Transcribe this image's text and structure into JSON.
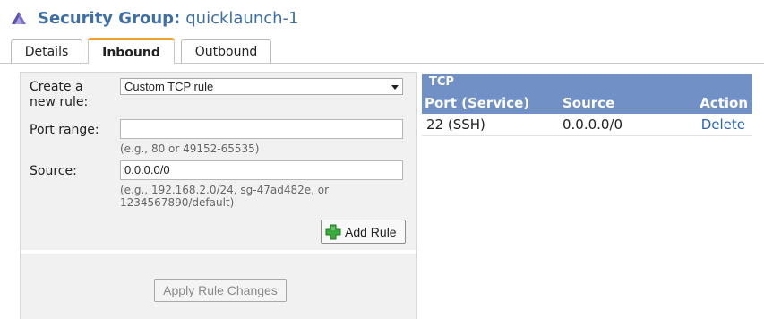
{
  "header": {
    "title_label": "Security Group:",
    "title_value": "quicklaunch-1",
    "icon": "security-group-icon"
  },
  "tabs": [
    {
      "label": "Details",
      "active": false
    },
    {
      "label": "Inbound",
      "active": true
    },
    {
      "label": "Outbound",
      "active": false
    }
  ],
  "form": {
    "create_rule_label": "Create a new rule:",
    "rule_type_selected": "Custom TCP rule",
    "port_range_label": "Port range:",
    "port_range_value": "",
    "port_range_hint": "(e.g., 80 or 49152-65535)",
    "source_label": "Source:",
    "source_value": "0.0.0.0/0",
    "source_hint": "(e.g., 192.168.2.0/24, sg-47ad482e, or 1234567890/default)",
    "add_rule_label": "Add Rule",
    "apply_label": "Apply Rule Changes"
  },
  "rules": {
    "protocol": "TCP",
    "columns": [
      "Port (Service)",
      "Source",
      "Action"
    ],
    "rows": [
      {
        "port": "22 (SSH)",
        "source": "0.0.0.0/0",
        "action": "Delete"
      }
    ]
  },
  "colors": {
    "title": "#3d6ea8",
    "active_tab_accent": "#f0a030",
    "table_header": "#7190c6",
    "link": "#2a63b4",
    "add_icon": "#3caa3c"
  }
}
